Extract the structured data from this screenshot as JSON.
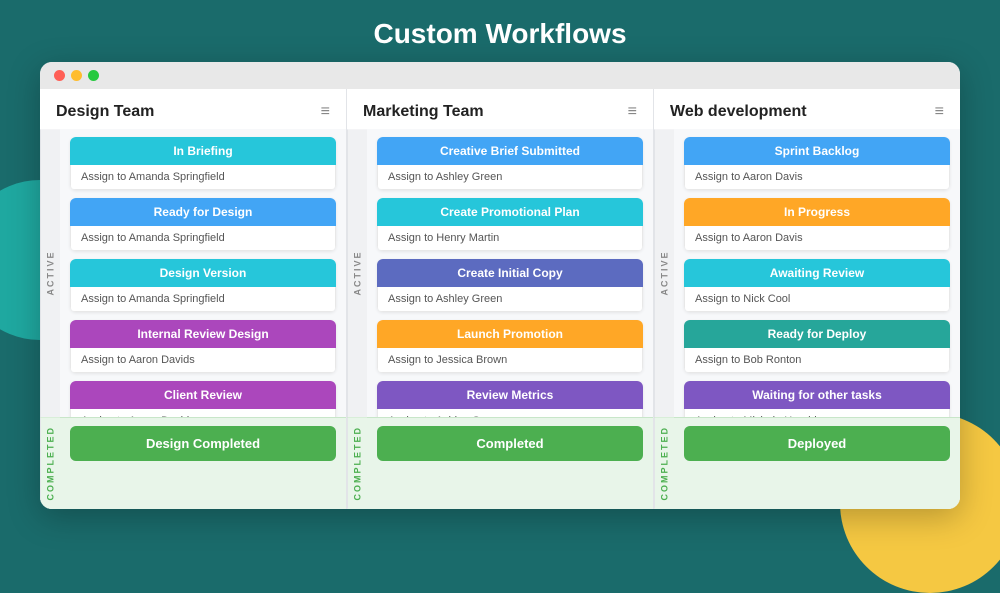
{
  "page": {
    "title": "Custom Workflows"
  },
  "columns": [
    {
      "id": "design-team",
      "title": "Design Team",
      "menu_icon": "≡",
      "active_label": "ACTIVE",
      "completed_label": "COMPLETED",
      "cards": [
        {
          "label": "In Briefing",
          "color": "cyan",
          "assign": "Assign to Amanda Springfield"
        },
        {
          "label": "Ready for Design",
          "color": "blue",
          "assign": "Assign to Amanda Springfield"
        },
        {
          "label": "Design Version",
          "color": "cyan",
          "assign": "Assign to Amanda Springfield"
        },
        {
          "label": "Internal Review Design",
          "color": "purple",
          "assign": "Assign to Aaron Davids"
        },
        {
          "label": "Client Review",
          "color": "purple",
          "assign": "Assign to Aaron Davids"
        }
      ],
      "completed_card": {
        "label": "Design Completed",
        "color": "green"
      }
    },
    {
      "id": "marketing-team",
      "title": "Marketing Team",
      "menu_icon": "≡",
      "active_label": "ACTIVE",
      "completed_label": "COMPLETED",
      "cards": [
        {
          "label": "Creative Brief Submitted",
          "color": "blue",
          "assign": "Assign to Ashley Green"
        },
        {
          "label": "Create Promotional Plan",
          "color": "cyan",
          "assign": "Assign to Henry Martin"
        },
        {
          "label": "Create Initial Copy",
          "color": "indigo",
          "assign": "Assign to Ashley Green"
        },
        {
          "label": "Launch Promotion",
          "color": "orange",
          "assign": "Assign to Jessica Brown"
        },
        {
          "label": "Review Metrics",
          "color": "light-purple",
          "assign": "Assign to Ashley Green"
        }
      ],
      "completed_card": {
        "label": "Completed",
        "color": "green"
      }
    },
    {
      "id": "web-development",
      "title": "Web development",
      "menu_icon": "≡",
      "active_label": "ACTIVE",
      "completed_label": "COMPLETED",
      "cards": [
        {
          "label": "Sprint Backlog",
          "color": "blue",
          "assign": "Assign to Aaron Davis"
        },
        {
          "label": "In Progress",
          "color": "orange",
          "assign": "Assign to Aaron Davis"
        },
        {
          "label": "Awaiting Review",
          "color": "cyan",
          "assign": "Assign to Nick Cool"
        },
        {
          "label": "Ready for Deploy",
          "color": "teal",
          "assign": "Assign to Bob Ronton"
        },
        {
          "label": "Waiting for other tasks",
          "color": "light-purple",
          "assign": "Assign to Michele Hendrix"
        }
      ],
      "completed_card": {
        "label": "Deployed",
        "color": "green"
      }
    }
  ]
}
